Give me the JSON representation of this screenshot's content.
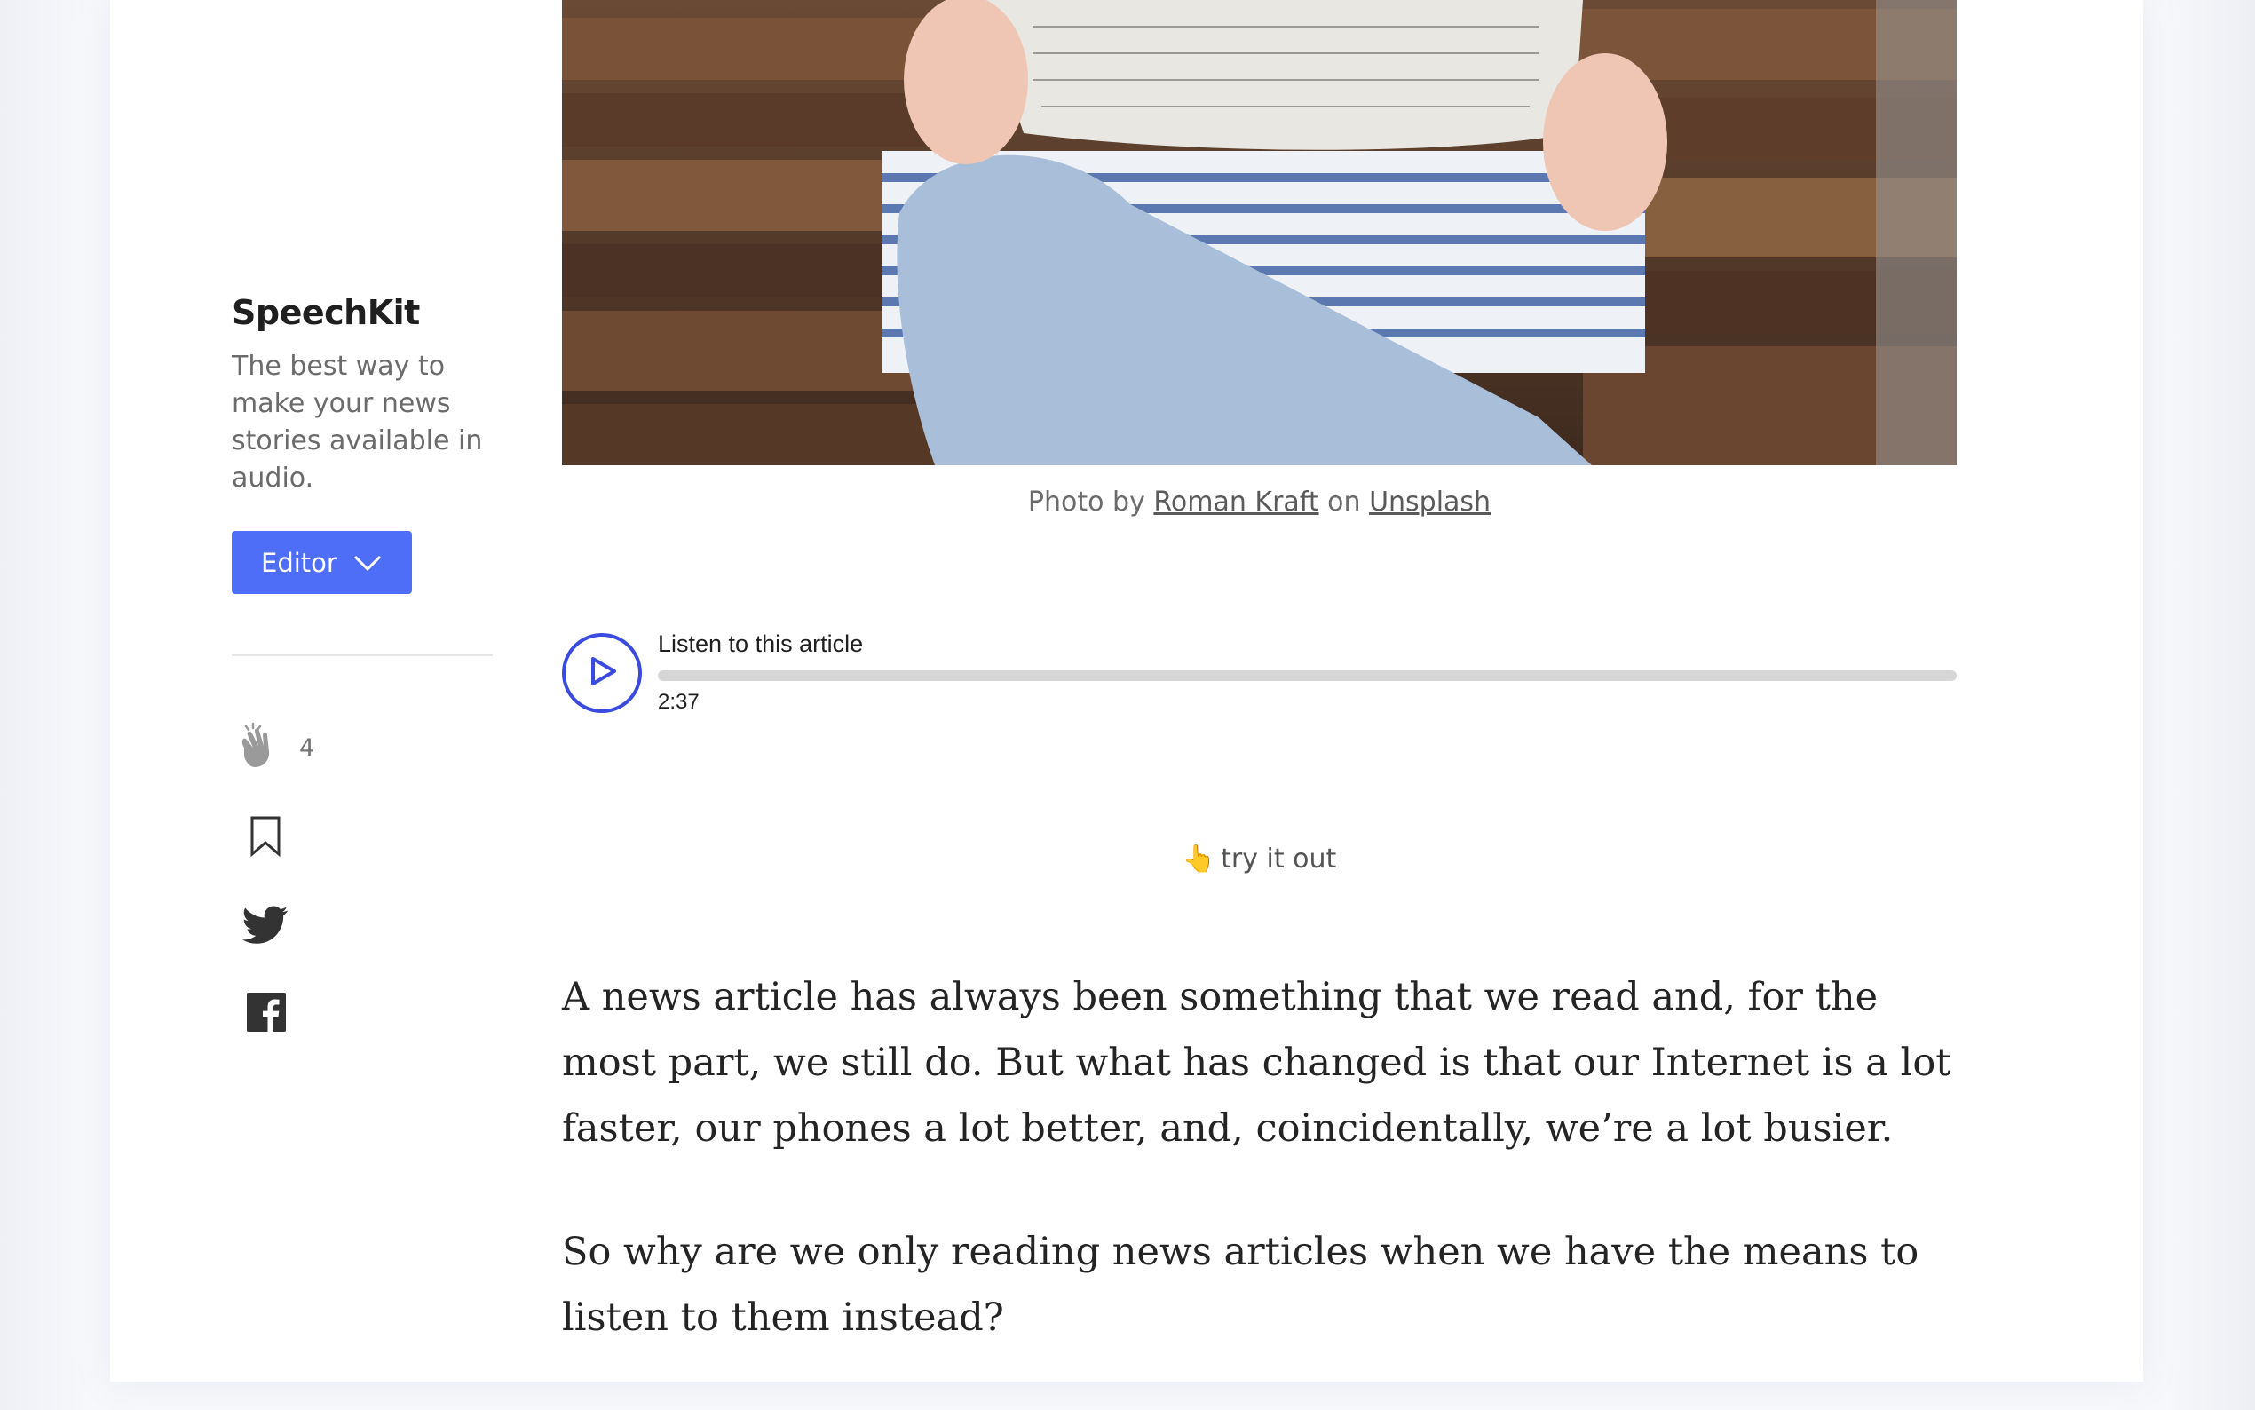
{
  "sidebar": {
    "publication_name": "SpeechKit",
    "publication_description": "The best way to make your news stories available in audio.",
    "editor_button_label": "Editor",
    "clap_count": "4",
    "icons": [
      "clap-icon",
      "bookmark-icon",
      "twitter-icon",
      "facebook-icon"
    ]
  },
  "hero": {
    "caption_prefix": "Photo by",
    "caption_author": "Roman Kraft",
    "caption_middle": "on",
    "caption_source": "Unsplash"
  },
  "player": {
    "title": "Listen to this article",
    "duration": "2:37",
    "progress": 0,
    "accent_color": "#3b4be0"
  },
  "try_it": {
    "emoji": "👆",
    "label": "try it out"
  },
  "article": {
    "paragraphs": [
      "A news article has always been something that we read and, for the most part, we still do. But what has changed is that our Internet is a lot faster, our phones a lot better, and, coincidentally, we’re a lot busier.",
      "So why are we only reading news articles when we have the means to listen to them instead?"
    ]
  },
  "colors": {
    "editor_button": "#4f6ef7",
    "text_primary": "#242424",
    "text_secondary": "#6b6b6b"
  }
}
